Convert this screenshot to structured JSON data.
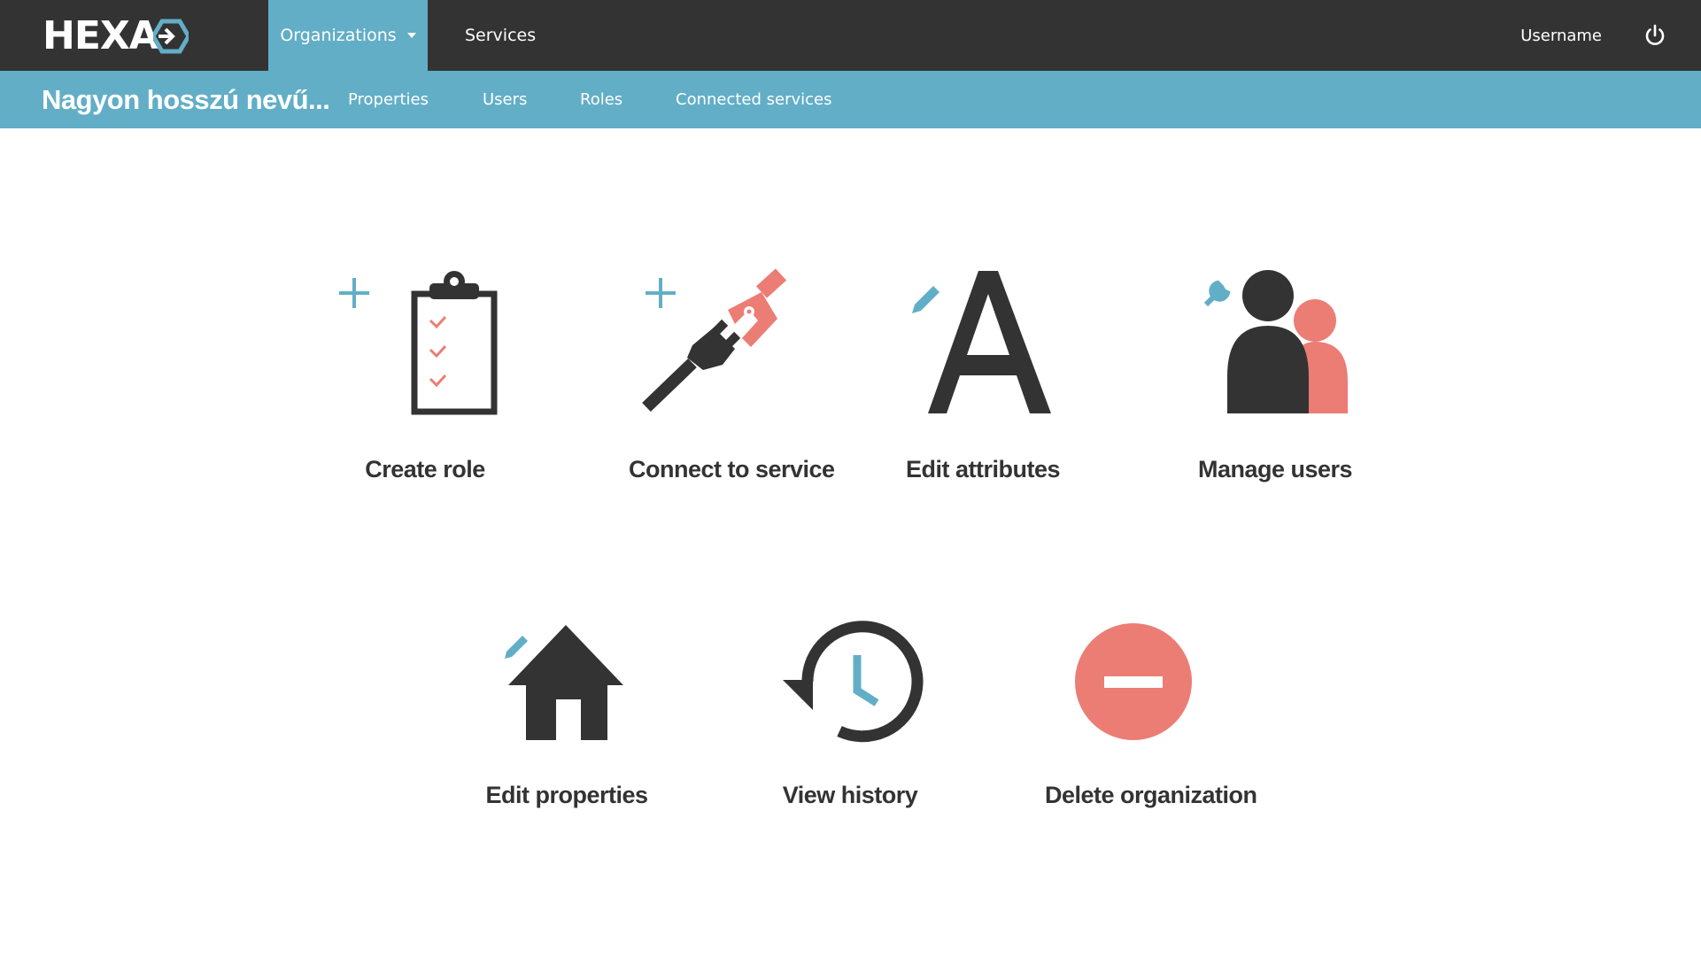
{
  "colors": {
    "dark": "#333333",
    "accent": "#62aec7",
    "coral": "#eb7d74",
    "white": "#ffffff"
  },
  "header": {
    "logo_text": "HEXA",
    "nav": [
      {
        "label": "Organizations",
        "active": true,
        "has_dropdown": true
      },
      {
        "label": "Services",
        "active": false
      }
    ],
    "username": "Username",
    "power_icon": "power-icon"
  },
  "subnav": {
    "org_title": "Nagyon hosszú nevű...",
    "items": [
      {
        "label": "Properties"
      },
      {
        "label": "Users"
      },
      {
        "label": "Roles"
      },
      {
        "label": "Connected services"
      }
    ]
  },
  "actions": [
    {
      "label": "Create role",
      "icon": "clipboard-plus-icon"
    },
    {
      "label": "Connect to service",
      "icon": "plug-plus-icon"
    },
    {
      "label": "Edit attributes",
      "icon": "letter-a-pencil-icon"
    },
    {
      "label": "Manage users",
      "icon": "users-wrench-icon"
    },
    {
      "label": "Edit properties",
      "icon": "house-pencil-icon"
    },
    {
      "label": "View history",
      "icon": "history-icon"
    },
    {
      "label": "Delete organization",
      "icon": "minus-circle-icon"
    }
  ]
}
